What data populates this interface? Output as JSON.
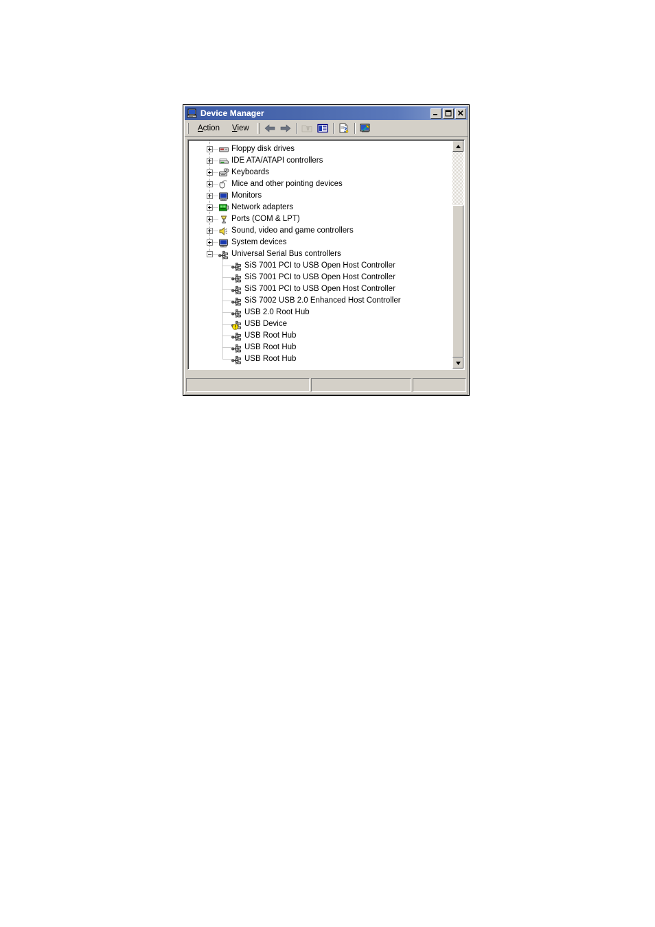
{
  "window": {
    "title": "Device Manager",
    "title_icon": "computer-icon",
    "buttons": {
      "minimize": "Minimize",
      "maximize": "Maximize",
      "close": "Close"
    }
  },
  "menu": {
    "items": [
      {
        "label": "Action",
        "accel": "A"
      },
      {
        "label": "View",
        "accel": "V"
      }
    ]
  },
  "toolbar": {
    "buttons": [
      {
        "name": "back-icon",
        "tooltip": "Back",
        "enabled": true
      },
      {
        "name": "forward-icon",
        "tooltip": "Forward",
        "enabled": true
      },
      {
        "name": "up-one-level-icon",
        "tooltip": "Up one level",
        "enabled": false
      },
      {
        "name": "properties-icon",
        "tooltip": "Properties",
        "enabled": true
      },
      {
        "name": "help-icon",
        "tooltip": "Help",
        "enabled": true
      },
      {
        "name": "scan-for-hardware-changes-icon",
        "tooltip": "Scan for hardware changes",
        "enabled": true
      }
    ]
  },
  "tree": {
    "rows": [
      {
        "indent": 0,
        "expander": "plus",
        "icon": "floppy-disk-icon",
        "label": "Floppy disk drives"
      },
      {
        "indent": 0,
        "expander": "plus",
        "icon": "ide-controller-icon",
        "label": "IDE ATA/ATAPI controllers"
      },
      {
        "indent": 0,
        "expander": "plus",
        "icon": "keyboard-icon",
        "label": "Keyboards"
      },
      {
        "indent": 0,
        "expander": "plus",
        "icon": "mouse-icon",
        "label": "Mice and other pointing devices"
      },
      {
        "indent": 0,
        "expander": "plus",
        "icon": "monitor-icon",
        "label": "Monitors"
      },
      {
        "indent": 0,
        "expander": "plus",
        "icon": "network-adapter-icon",
        "label": "Network adapters"
      },
      {
        "indent": 0,
        "expander": "plus",
        "icon": "port-icon",
        "label": "Ports (COM & LPT)"
      },
      {
        "indent": 0,
        "expander": "plus",
        "icon": "sound-icon",
        "label": "Sound, video and game controllers"
      },
      {
        "indent": 0,
        "expander": "plus",
        "icon": "system-device-icon",
        "label": "System devices"
      },
      {
        "indent": 0,
        "expander": "minus",
        "icon": "usb-icon",
        "label": "Universal Serial Bus controllers"
      },
      {
        "indent": 1,
        "expander": "none",
        "icon": "usb-icon",
        "label": "SiS 7001 PCI to USB Open Host Controller"
      },
      {
        "indent": 1,
        "expander": "none",
        "icon": "usb-icon",
        "label": "SiS 7001 PCI to USB Open Host Controller"
      },
      {
        "indent": 1,
        "expander": "none",
        "icon": "usb-icon",
        "label": "SiS 7001 PCI to USB Open Host Controller"
      },
      {
        "indent": 1,
        "expander": "none",
        "icon": "usb-icon",
        "label": "SiS 7002 USB 2.0 Enhanced Host Controller"
      },
      {
        "indent": 1,
        "expander": "none",
        "icon": "usb-icon",
        "label": "USB 2.0 Root Hub"
      },
      {
        "indent": 1,
        "expander": "none",
        "icon": "usb-warning-icon",
        "label": "USB Device"
      },
      {
        "indent": 1,
        "expander": "none",
        "icon": "usb-icon",
        "label": "USB Root Hub"
      },
      {
        "indent": 1,
        "expander": "none",
        "icon": "usb-icon",
        "label": "USB Root Hub"
      },
      {
        "indent": 1,
        "expander": "none",
        "icon": "usb-icon",
        "label": "USB Root Hub"
      }
    ]
  },
  "scrollbar": {
    "up_arrow": "scroll-up-icon",
    "down_arrow": "scroll-down-icon",
    "thumb_top_pct": 26,
    "thumb_height_pct": 74
  },
  "statusbar": {
    "panes": [
      "",
      "",
      ""
    ]
  },
  "colors": {
    "titlebar_start": "#3c5ba6",
    "titlebar_end": "#8fa4d0",
    "face": "#d4d0c8",
    "warning_badge": "#ffe400",
    "network_green": "#00a000",
    "monitor_blue": "#1a3ab0"
  }
}
